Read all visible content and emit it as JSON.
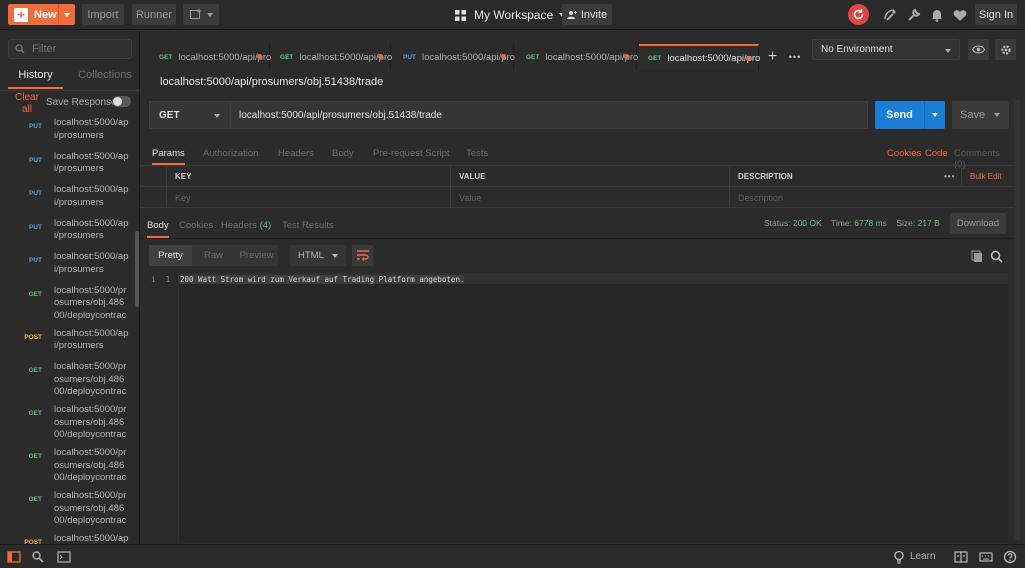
{
  "topbar": {
    "new_label": "New",
    "import_label": "Import",
    "runner_label": "Runner",
    "workspace_label": "My Workspace",
    "invite_label": "Invite",
    "signin_label": "Sign In"
  },
  "sidebar": {
    "filter_placeholder": "Filter",
    "tab_history": "History",
    "tab_collections": "Collections",
    "clear_all": "Clear all",
    "save_responses": "Save Responses",
    "items": [
      {
        "method": "PUT",
        "url": "localhost:5000/ap\ni/prosumers"
      },
      {
        "method": "PUT",
        "url": "localhost:5000/ap\ni/prosumers"
      },
      {
        "method": "PUT",
        "url": "localhost:5000/ap\ni/prosumers"
      },
      {
        "method": "PUT",
        "url": "localhost:5000/ap\ni/prosumers"
      },
      {
        "method": "PUT",
        "url": "localhost:5000/ap\ni/prosumers"
      },
      {
        "method": "GET",
        "url": "localhost:5000/pr\nosumers/obj.486\n00/deploycontrac"
      },
      {
        "method": "POST",
        "url": "localhost:5000/ap\ni/prosumers"
      },
      {
        "method": "GET",
        "url": "localhost:5000/pr\nosumers/obj.486\n00/deploycontrac"
      },
      {
        "method": "GET",
        "url": "localhost:5000/pr\nosumers/obj.486\n00/deploycontrac"
      },
      {
        "method": "GET",
        "url": "localhost:5000/pr\nosumers/obj.486\n00/deploycontrac"
      },
      {
        "method": "GET",
        "url": "localhost:5000/pr\nosumers/obj.486\n00/deploycontrac"
      },
      {
        "method": "POST",
        "url": "localhost:5000/ap\ni/prosumers"
      }
    ]
  },
  "tabs": [
    {
      "method": "GET",
      "label": "localhost:5000/api/pro"
    },
    {
      "method": "GET",
      "label": "localhost:5000/api/pro"
    },
    {
      "method": "PUT",
      "label": "localhost:5000/api/pro"
    },
    {
      "method": "GET",
      "label": "localhost:5000/api/pro"
    },
    {
      "method": "GET",
      "label": "localhost:5000/api/pro"
    }
  ],
  "environment": "No Environment",
  "request": {
    "title": "localhost:5000/api/prosumers/obj.51438/trade",
    "method": "GET",
    "url": "localhost:5000/api/prosumers/obj.51438/trade",
    "send_label": "Send",
    "save_label": "Save",
    "tabs": [
      "Params",
      "Authorization",
      "Headers",
      "Body",
      "Pre-request Script",
      "Tests"
    ],
    "cookies_label": "Cookies",
    "code_label": "Code",
    "comments_label": "Comments (0)"
  },
  "params": {
    "col_key": "KEY",
    "col_value": "VALUE",
    "col_description": "DESCRIPTION",
    "more": "•••",
    "bulk_edit": "Bulk Edit",
    "key_placeholder": "Key",
    "value_placeholder": "Value",
    "description_placeholder": "Description"
  },
  "response": {
    "tabs": {
      "body": "Body",
      "cookies": "Cookies",
      "headers": "Headers",
      "headers_count": "(4)",
      "test_results": "Test Results"
    },
    "status_label": "Status:",
    "status_value": "200 OK",
    "time_label": "Time:",
    "time_value": "6778 ms",
    "size_label": "Size:",
    "size_value": "217 B",
    "download_label": "Download",
    "view_pretty": "Pretty",
    "view_raw": "Raw",
    "view_preview": "Preview",
    "format": "HTML",
    "line_number": "1",
    "line_marker": "i",
    "body_text": "200 Watt Strom wird zum Verkauf auf Trading Platform angeboten."
  },
  "bottombar": {
    "learn_label": "Learn"
  },
  "colors": {
    "accent": "#f26b3a",
    "send": "#1b7ed6",
    "get": "#5fc18c",
    "put": "#4aa3e8",
    "post": "#f7b23b"
  }
}
